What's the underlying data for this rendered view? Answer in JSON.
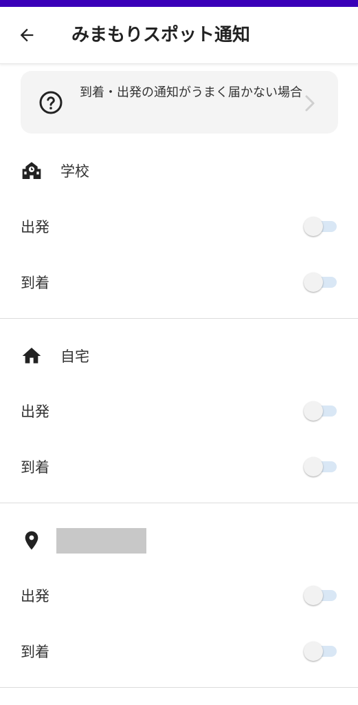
{
  "app_bar": {
    "title": "みまもりスポット通知",
    "back_icon": "arrow-left-icon"
  },
  "help_card": {
    "text": "到着・出発の通知がうまく届かない場合",
    "icon": "question-circle-icon",
    "chevron": "chevron-right-icon"
  },
  "sections": [
    {
      "title": "学校",
      "icon": "school-icon",
      "rows": [
        {
          "label": "出発",
          "enabled": false
        },
        {
          "label": "到着",
          "enabled": false
        }
      ]
    },
    {
      "title": "自宅",
      "icon": "home-icon",
      "rows": [
        {
          "label": "出発",
          "enabled": false
        },
        {
          "label": "到着",
          "enabled": false
        }
      ]
    },
    {
      "title": "",
      "icon": "location-pin-icon",
      "rows": [
        {
          "label": "出発",
          "enabled": false
        },
        {
          "label": "到着",
          "enabled": false
        }
      ]
    }
  ],
  "colors": {
    "status_bar": "#3a00b8",
    "toggle_track_off": "#d9e7f5",
    "toggle_thumb_off": "#f2f2f2",
    "placeholder_block": "#c8c8c8"
  }
}
